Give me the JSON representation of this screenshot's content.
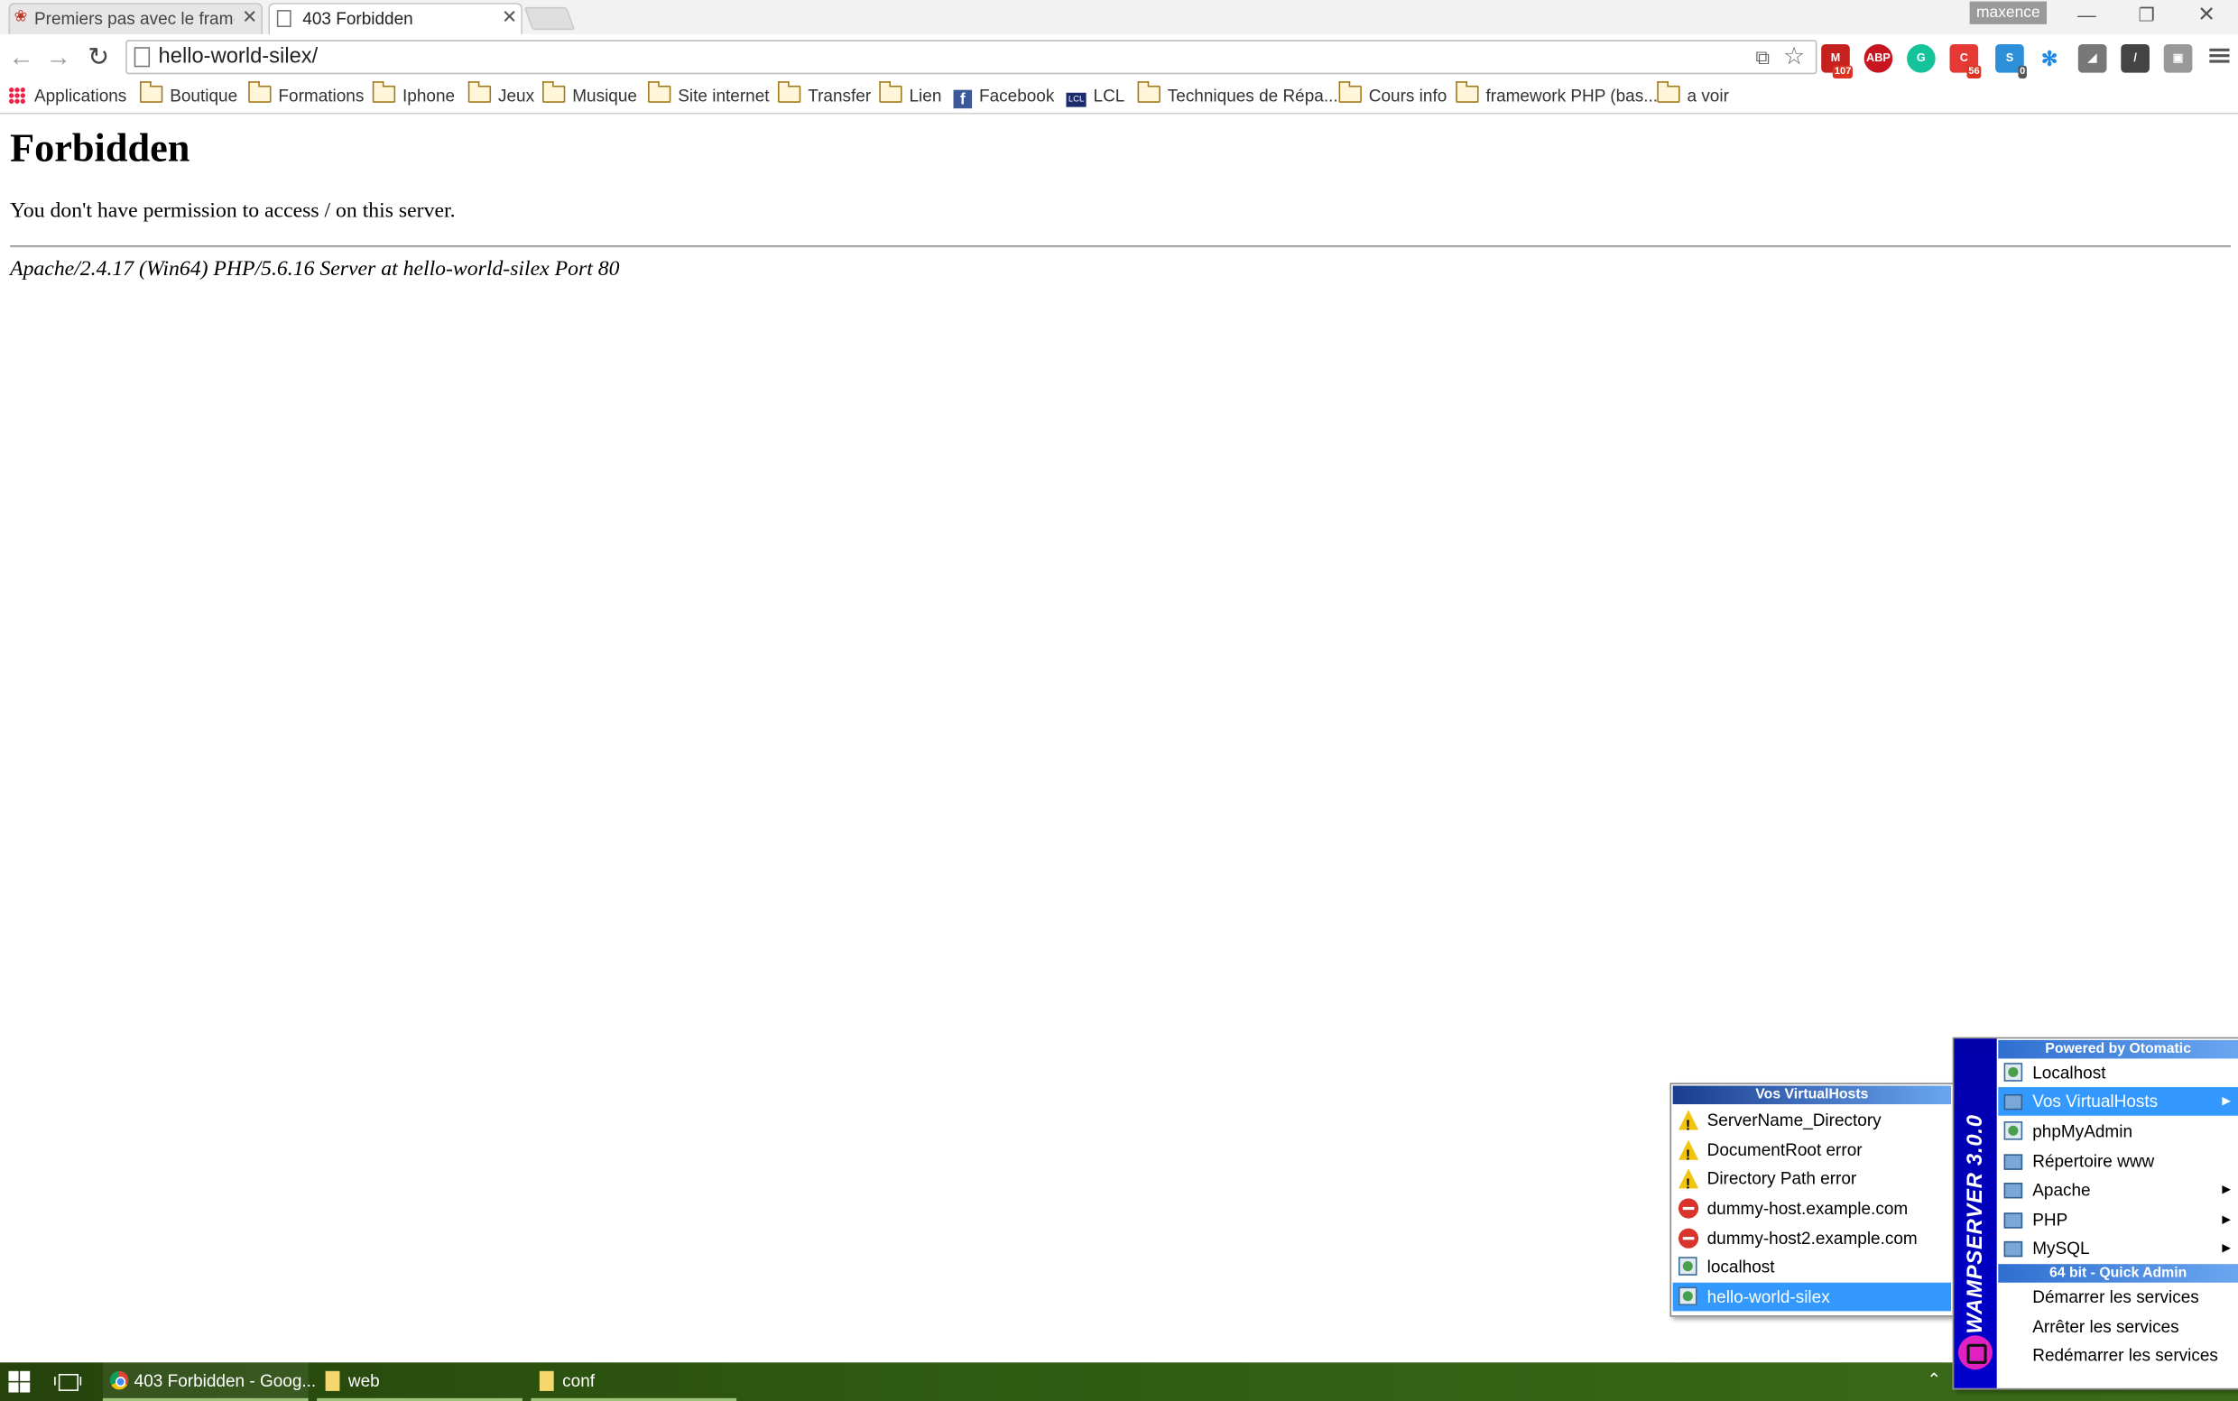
{
  "browser": {
    "tabs": [
      {
        "title": "Premiers pas avec le framew",
        "active": false
      },
      {
        "title": "403 Forbidden",
        "active": true
      }
    ],
    "profile_name": "maxence",
    "url": "hello-world-silex/",
    "extension_badges": {
      "gmail": "107",
      "ext_red": "56",
      "ext_blue": "0"
    },
    "extension_labels": {
      "abp": "ABP"
    }
  },
  "bookmarks": [
    {
      "label": "Applications",
      "icon": "apps-grid-icon"
    },
    {
      "label": "Boutique",
      "icon": "folder-icon"
    },
    {
      "label": "Formations",
      "icon": "folder-icon"
    },
    {
      "label": "Iphone",
      "icon": "folder-icon"
    },
    {
      "label": "Jeux",
      "icon": "folder-icon"
    },
    {
      "label": "Musique",
      "icon": "folder-icon"
    },
    {
      "label": "Site internet",
      "icon": "folder-icon"
    },
    {
      "label": "Transfer",
      "icon": "folder-icon"
    },
    {
      "label": "Lien",
      "icon": "folder-icon"
    },
    {
      "label": "Facebook",
      "icon": "facebook-icon"
    },
    {
      "label": "LCL",
      "icon": "lcl-icon"
    },
    {
      "label": "Techniques de Répa...",
      "icon": "folder-icon"
    },
    {
      "label": "Cours info",
      "icon": "folder-icon"
    },
    {
      "label": "framework PHP (bas...",
      "icon": "folder-icon"
    },
    {
      "label": "a voir",
      "icon": "folder-icon"
    }
  ],
  "page": {
    "heading": "Forbidden",
    "message": "You don't have permission to access / on this server.",
    "address": "Apache/2.4.17 (Win64) PHP/5.6.16 Server at hello-world-silex Port 80"
  },
  "taskbar": {
    "items": [
      {
        "label": "403 Forbidden - Goog..."
      },
      {
        "label": "web"
      },
      {
        "label": "conf"
      }
    ]
  },
  "wamp": {
    "sidebar_title": "WAMPSERVER 3.0.0",
    "header_top": "Powered by Otomatic",
    "items": [
      {
        "label": "Localhost",
        "icon": "page-icon",
        "submenu": false,
        "selected": false
      },
      {
        "label": "Vos VirtualHosts",
        "icon": "folder-icon",
        "submenu": true,
        "selected": true
      },
      {
        "label": "phpMyAdmin",
        "icon": "page-icon",
        "submenu": false,
        "selected": false
      },
      {
        "label": "Répertoire www",
        "icon": "folder-icon",
        "submenu": false,
        "selected": false
      },
      {
        "label": "Apache",
        "icon": "folder-icon",
        "submenu": true,
        "selected": false
      },
      {
        "label": "PHP",
        "icon": "folder-icon",
        "submenu": true,
        "selected": false
      },
      {
        "label": "MySQL",
        "icon": "folder-icon",
        "submenu": true,
        "selected": false
      }
    ],
    "header_quick": "64 bit - Quick Admin",
    "quick_items": [
      {
        "label": "Démarrer les services"
      },
      {
        "label": "Arrêter les services"
      },
      {
        "label": "Redémarrer les services"
      }
    ]
  },
  "virtualhosts": {
    "header": "Vos VirtualHosts",
    "items": [
      {
        "label": "ServerName_Directory",
        "icon": "warning-icon",
        "selected": false
      },
      {
        "label": "DocumentRoot error",
        "icon": "warning-icon",
        "selected": false
      },
      {
        "label": "Directory Path error",
        "icon": "warning-icon",
        "selected": false
      },
      {
        "label": "dummy-host.example.com",
        "icon": "stop-icon",
        "selected": false
      },
      {
        "label": "dummy-host2.example.com",
        "icon": "stop-icon",
        "selected": false
      },
      {
        "label": "localhost",
        "icon": "page-icon",
        "selected": false
      },
      {
        "label": "hello-world-silex",
        "icon": "page-icon",
        "selected": true
      }
    ]
  },
  "colors": {
    "menu_selection": "#3399ff",
    "wamp_sidebar": "#0000cc",
    "taskbar": "#2f5a12"
  }
}
